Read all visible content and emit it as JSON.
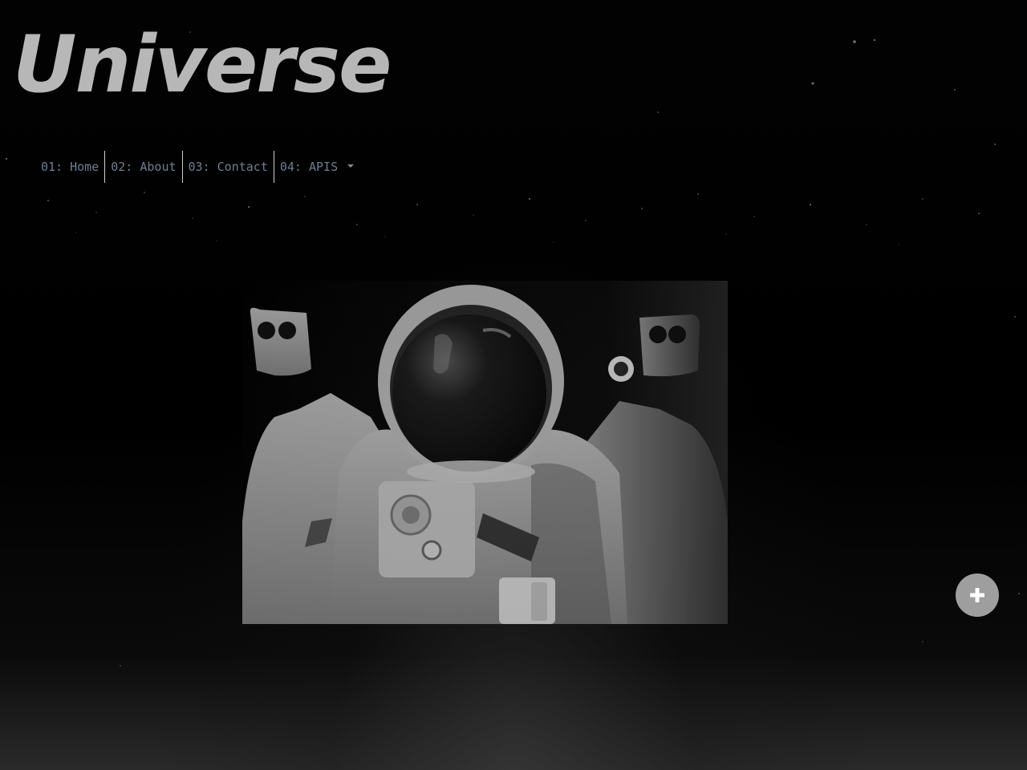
{
  "site": {
    "title": "Universe"
  },
  "nav": {
    "items": [
      {
        "label": "01: Home"
      },
      {
        "label": "02: About"
      },
      {
        "label": "03: Contact"
      },
      {
        "label": "04: APIS",
        "has_dropdown": true
      }
    ]
  },
  "hero": {
    "image_subject": "astronaut-in-spacesuit"
  },
  "fab": {
    "icon": "plus-icon"
  },
  "colors": {
    "background": "#000000",
    "title": "#b7b7b7",
    "nav_text": "#6f7f91",
    "nav_divider": "#d0d0d0",
    "fab": "#9e9e9e"
  }
}
